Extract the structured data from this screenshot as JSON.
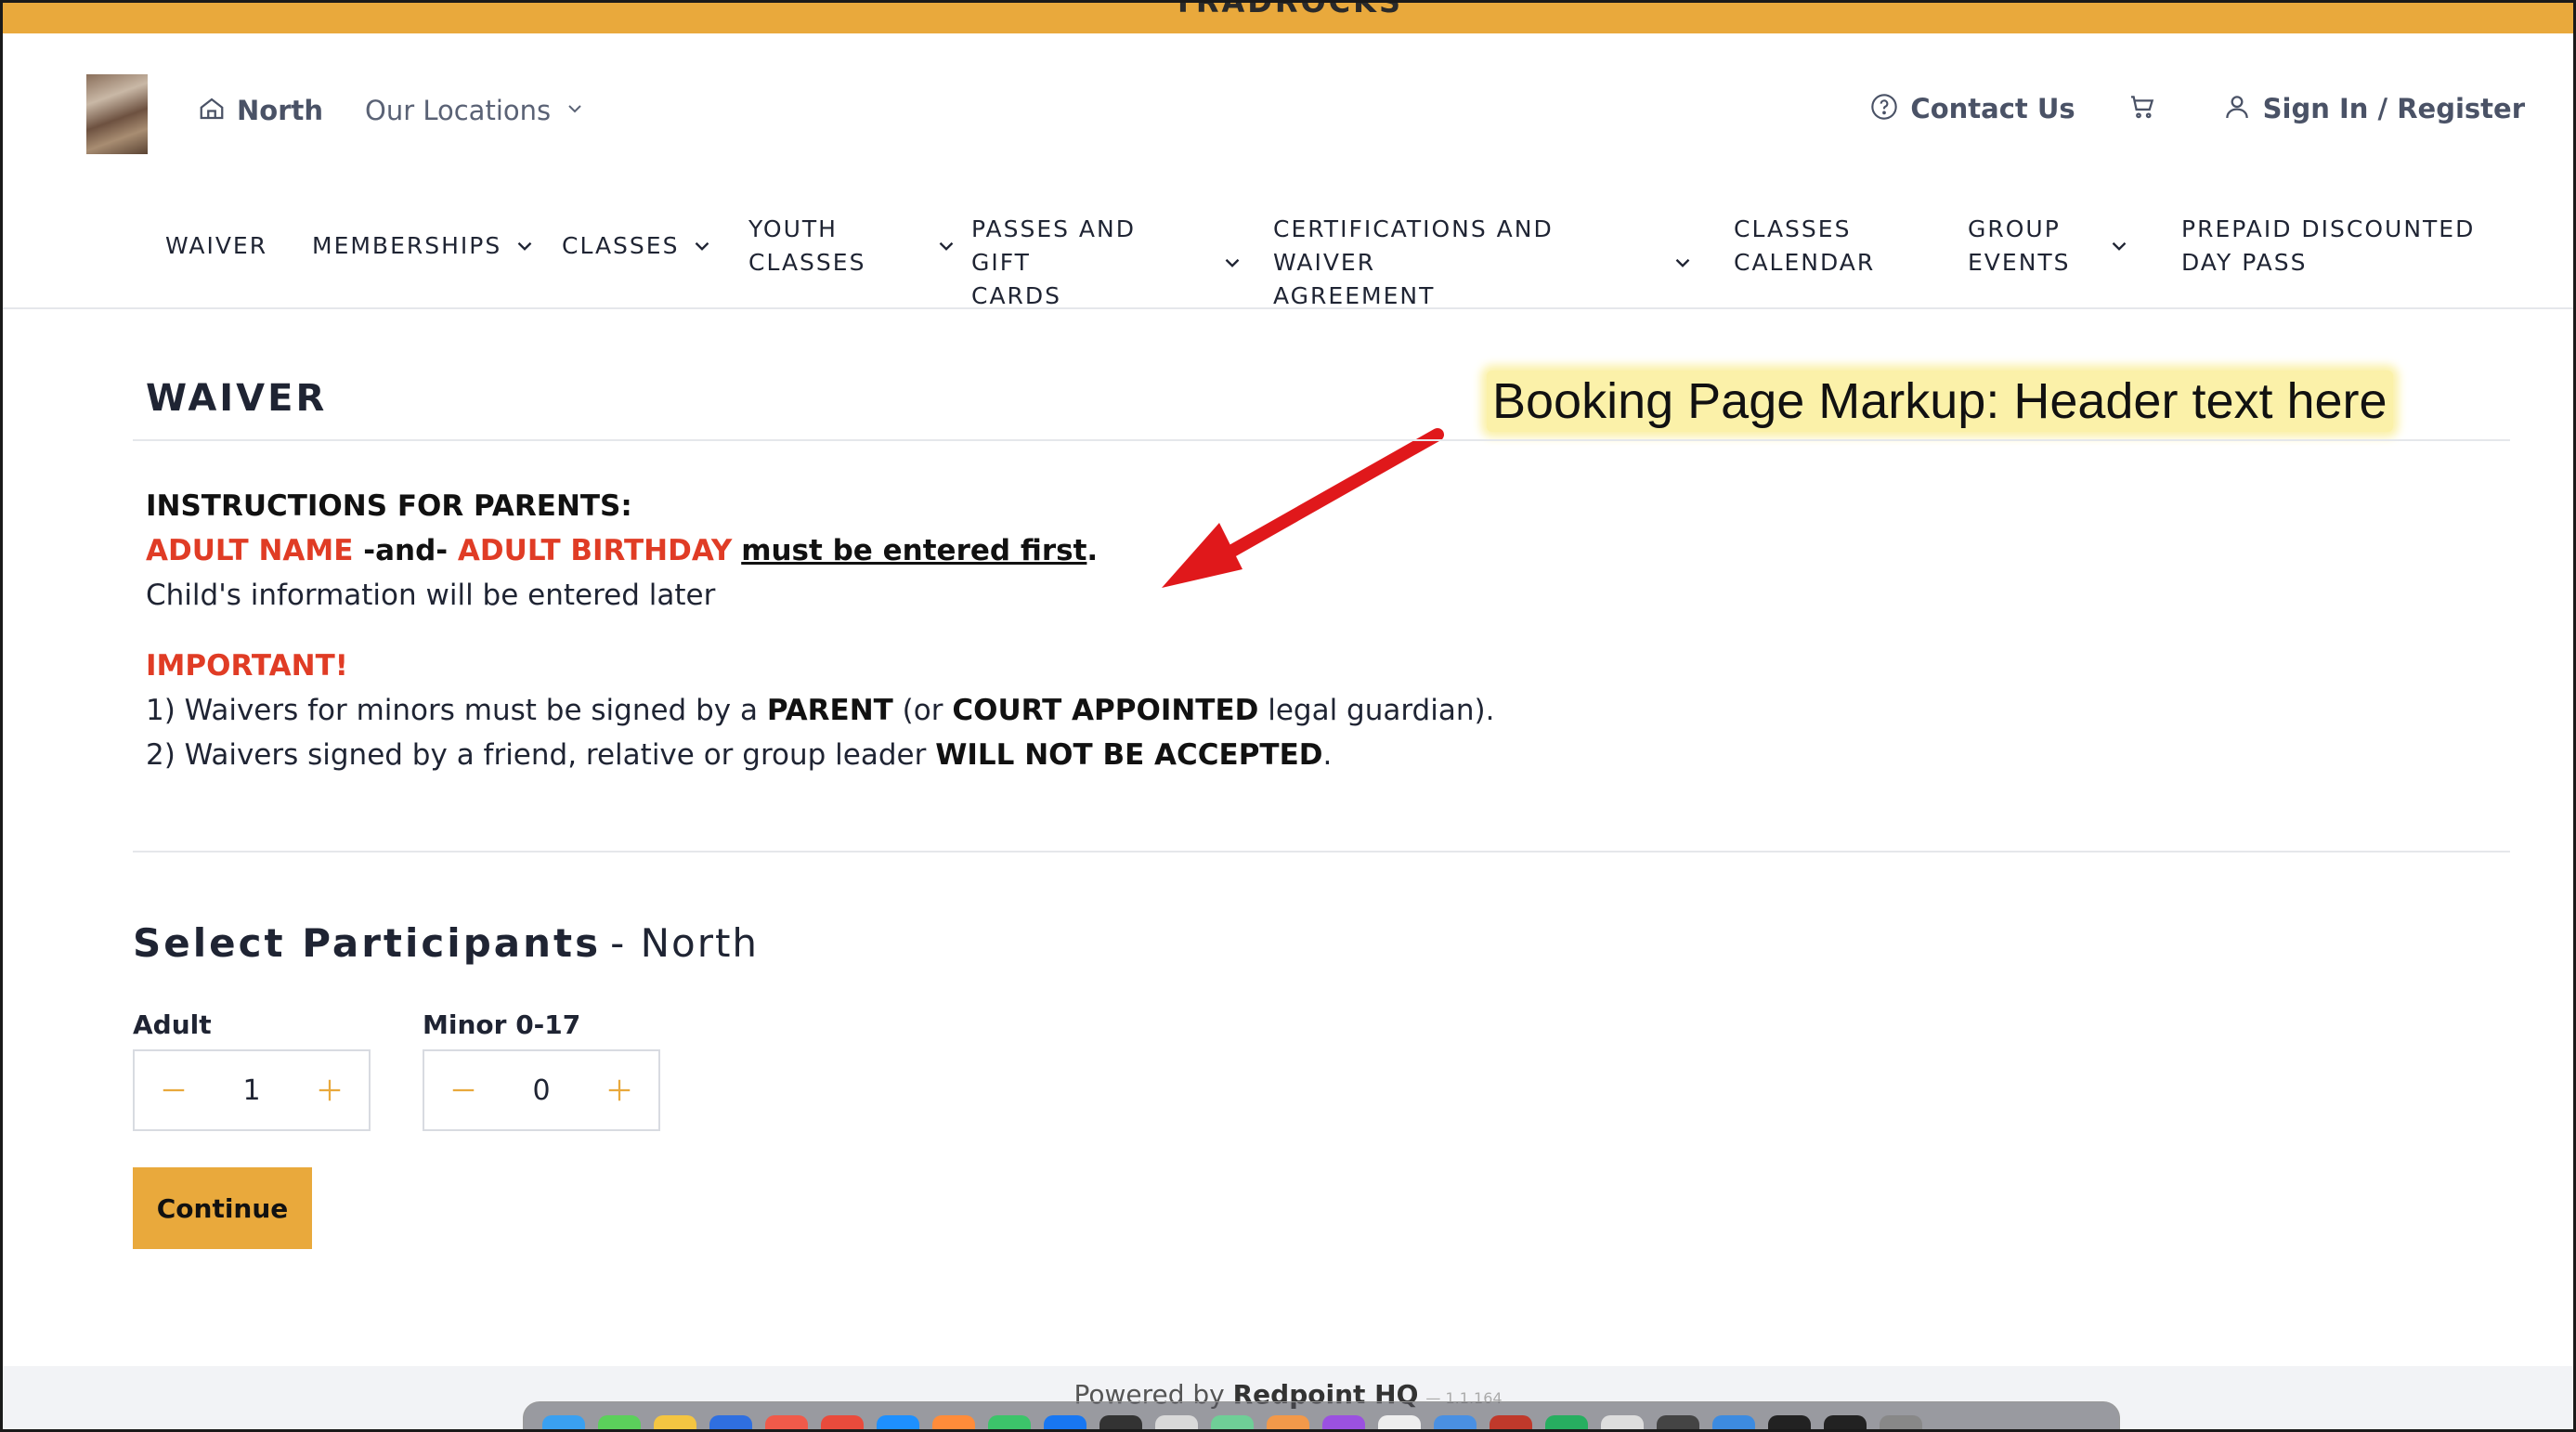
{
  "topbar": {
    "text": "TRADROCKS"
  },
  "header": {
    "home_label": "North",
    "locations_label": "Our Locations",
    "contact_label": "Contact Us",
    "signin_label": "Sign In / Register"
  },
  "menu": {
    "items": [
      {
        "label": "WAIVER"
      },
      {
        "label": "MEMBERSHIPS"
      },
      {
        "label": "CLASSES"
      },
      {
        "label": "YOUTH",
        "label2": "CLASSES"
      },
      {
        "label": "PASSES AND GIFT",
        "label2": "CARDS"
      },
      {
        "label": "CERTIFICATIONS AND WAIVER",
        "label2": "AGREEMENT"
      },
      {
        "label": "CLASSES",
        "label2": "CALENDAR"
      },
      {
        "label": "GROUP",
        "label2": "EVENTS"
      },
      {
        "label": "PREPAID DISCOUNTED",
        "label2": "DAY PASS"
      }
    ]
  },
  "section": {
    "title": "WAIVER"
  },
  "annotation": {
    "text": "Booking Page Markup: Header text here"
  },
  "instructions": {
    "heading": "INSTRUCTIONS FOR PARENTS:",
    "adult_name": "ADULT NAME",
    "and": " -and- ",
    "adult_birthday": "ADULT BIRTHDAY",
    "must": "must be entered first",
    "period": ".",
    "child_line": "Child's information will be entered later",
    "important": "IMPORTANT!",
    "line1_a": "1) Waivers for minors must be signed by a ",
    "line1_parent": "PARENT",
    "line1_b": " (or ",
    "line1_court": "COURT APPOINTED",
    "line1_c": " legal guardian).",
    "line2_a": "2) Waivers signed by a friend, relative or group leader ",
    "line2_bold": "WILL NOT BE ACCEPTED",
    "line2_c": "."
  },
  "participants": {
    "title": "Select Participants",
    "location": "- North",
    "adult_label": "Adult",
    "adult_value": "1",
    "minor_label": "Minor 0-17",
    "minor_value": "0"
  },
  "continue_label": "Continue",
  "footer": {
    "powered": "Powered by ",
    "brand": "Redpoint HQ",
    "version": "— 1.1.164"
  },
  "colors": {
    "accent": "#e9a93c",
    "warning": "#e03c25",
    "annotation_bg": "#fbf1a9"
  }
}
